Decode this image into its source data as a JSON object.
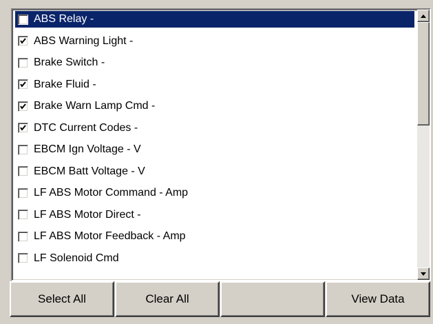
{
  "list": {
    "items": [
      {
        "label": "ABS Relay -",
        "checked": false,
        "selected": true
      },
      {
        "label": "ABS Warning Light -",
        "checked": true,
        "selected": false
      },
      {
        "label": "Brake Switch -",
        "checked": false,
        "selected": false
      },
      {
        "label": "Brake Fluid -",
        "checked": true,
        "selected": false
      },
      {
        "label": "Brake Warn Lamp Cmd -",
        "checked": true,
        "selected": false
      },
      {
        "label": "DTC Current Codes -",
        "checked": true,
        "selected": false
      },
      {
        "label": "EBCM Ign Voltage - V",
        "checked": false,
        "selected": false
      },
      {
        "label": "EBCM Batt Voltage - V",
        "checked": false,
        "selected": false
      },
      {
        "label": "LF ABS Motor Command - Amp",
        "checked": false,
        "selected": false
      },
      {
        "label": "LF ABS Motor Direct -",
        "checked": false,
        "selected": false
      },
      {
        "label": "LF ABS Motor Feedback - Amp",
        "checked": false,
        "selected": false
      },
      {
        "label": "LF Solenoid Cmd",
        "checked": false,
        "selected": false
      }
    ]
  },
  "buttons": {
    "select_all": "Select All",
    "clear_all": "Clear All",
    "blank": "",
    "view_data": "View Data"
  },
  "colors": {
    "selection": "#0a246a",
    "face": "#d4d0c8"
  }
}
